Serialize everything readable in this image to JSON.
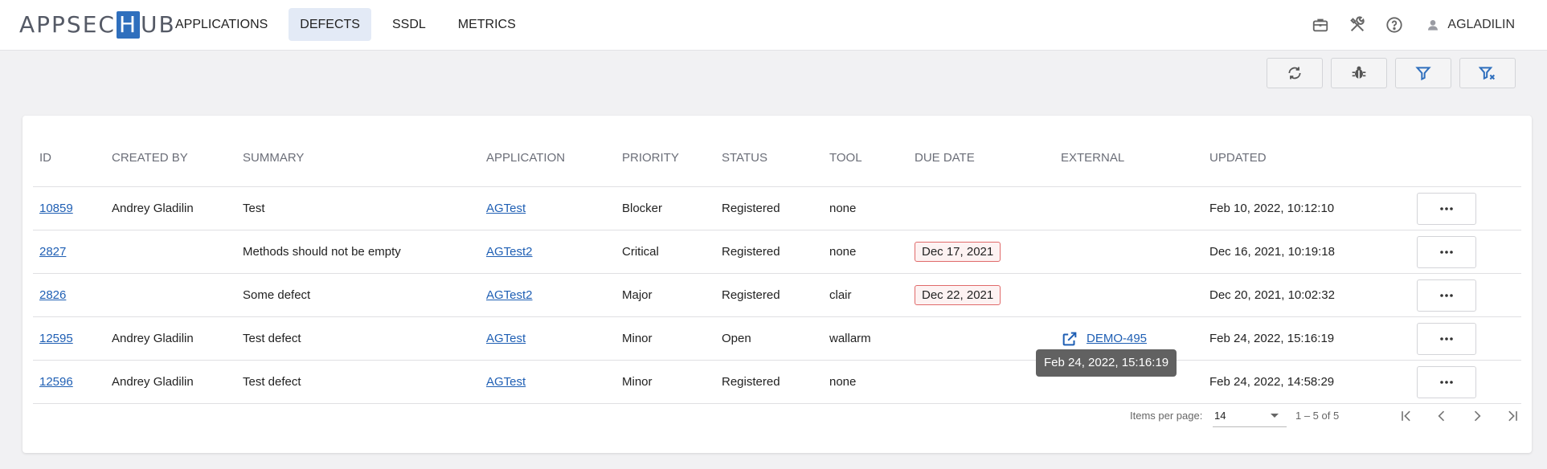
{
  "app": {
    "logo_left": "APPSEC",
    "logo_h": "H",
    "logo_right": "UB"
  },
  "nav": {
    "items": [
      {
        "label": "APPLICATIONS",
        "active": false
      },
      {
        "label": "DEFECTS",
        "active": true
      },
      {
        "label": "SSDL",
        "active": false
      },
      {
        "label": "METRICS",
        "active": false
      }
    ]
  },
  "header": {
    "icons": [
      "briefcase-icon",
      "tools-icon",
      "help-icon"
    ],
    "user": "AGLADILIN"
  },
  "toolbar": {
    "buttons": [
      "refresh-icon",
      "bug-icon",
      "filter-icon",
      "clear-filter-icon"
    ],
    "accent": "#2f6fbd"
  },
  "table": {
    "columns": [
      "ID",
      "CREATED BY",
      "SUMMARY",
      "APPLICATION",
      "PRIORITY",
      "STATUS",
      "TOOL",
      "DUE DATE",
      "EXTERNAL",
      "UPDATED"
    ],
    "rows": [
      {
        "id": "10859",
        "created_by": "Andrey Gladilin",
        "summary": "Test",
        "application": "AGTest",
        "priority": "Blocker",
        "status": "Registered",
        "tool": "none",
        "due_date": "",
        "external": "",
        "updated": "Feb 10, 2022, 10:12:10"
      },
      {
        "id": "2827",
        "created_by": "",
        "summary": "Methods should not be empty",
        "application": "AGTest2",
        "priority": "Critical",
        "status": "Registered",
        "tool": "none",
        "due_date": "Dec 17, 2021",
        "external": "",
        "updated": "Dec 16, 2021, 10:19:18"
      },
      {
        "id": "2826",
        "created_by": "",
        "summary": "Some defect",
        "application": "AGTest2",
        "priority": "Major",
        "status": "Registered",
        "tool": "clair",
        "due_date": "Dec 22, 2021",
        "external": "",
        "updated": "Dec 20, 2021, 10:02:32"
      },
      {
        "id": "12595",
        "created_by": "Andrey Gladilin",
        "summary": "Test defect",
        "application": "AGTest",
        "priority": "Minor",
        "status": "Open",
        "tool": "wallarm",
        "due_date": "",
        "external": "DEMO-495",
        "updated": "Feb 24, 2022, 15:16:19"
      },
      {
        "id": "12596",
        "created_by": "Andrey Gladilin",
        "summary": "Test defect",
        "application": "AGTest",
        "priority": "Minor",
        "status": "Registered",
        "tool": "none",
        "due_date": "",
        "external": "",
        "updated": "Feb 24, 2022, 14:58:29"
      }
    ],
    "more_icon": "more-horizontal-icon"
  },
  "tooltip": {
    "text": "Feb 24, 2022, 15:16:19"
  },
  "paginator": {
    "items_per_page_label": "Items per page:",
    "items_per_page_value": "14",
    "range_label": "1 – 5 of 5",
    "buttons": [
      "first-page-icon",
      "prev-page-icon",
      "next-page-icon",
      "last-page-icon"
    ]
  }
}
